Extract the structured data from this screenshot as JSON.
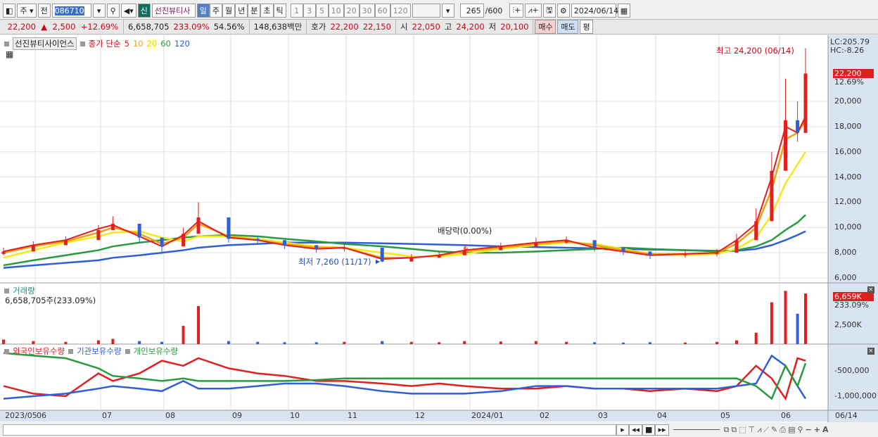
{
  "toolbar": {
    "market": "주",
    "prev_label": "전",
    "code": "086710",
    "name_badge": "신",
    "stock_name": "선진뷰티사",
    "periods": [
      "일",
      "주",
      "월",
      "년",
      "분",
      "초",
      "틱"
    ],
    "active_period": "일",
    "intervals": [
      "1",
      "3",
      "5",
      "10",
      "20",
      "30",
      "60",
      "120"
    ],
    "count": "265",
    "count_max": "/600",
    "date": "2024/06/14"
  },
  "quote": {
    "price": "22,200",
    "arrow": "▲",
    "change": "2,500",
    "change_pct": "+12.69%",
    "volume": "6,658,705",
    "volume_pct": "233.09%",
    "turnover": "54.56%",
    "amount": "148,638백만",
    "ask_label": "호가",
    "ask": "22,200",
    "bid": "22,150",
    "open_label": "시",
    "open": "22,050",
    "high_label": "고",
    "high": "24,200",
    "low_label": "저",
    "low": "20,100",
    "buy": "매수",
    "sell": "매도",
    "avg": "평"
  },
  "legend": {
    "stock": "선진뷰티사이언스",
    "ma_label": "종가 단순",
    "ma": [
      {
        "p": "5",
        "color": "#e0201e"
      },
      {
        "p": "10",
        "color": "#f0a010"
      },
      {
        "p": "20",
        "color": "#f0e020"
      },
      {
        "p": "60",
        "color": "#2a9a40"
      },
      {
        "p": "120",
        "color": "#2f5fd8"
      }
    ]
  },
  "annotations": {
    "high": "최고 24,200 (06/14)",
    "low": "최저 7,260 (11/17)",
    "dividend": "배당락(0.00%)"
  },
  "right_axis": {
    "lc": "LC:205.79",
    "hc": "HC:-8.26",
    "price_tag": "22,200",
    "pct_tag": "12.69%",
    "ticks": [
      "20,000",
      "18,000",
      "16,000",
      "14,000",
      "12,000",
      "10,000",
      "8,000",
      "6,000"
    ],
    "vol_tag": "6,659K",
    "vol_pct": "233.09%",
    "vol_tick": "2,500K",
    "inv_ticks": [
      "-500,000",
      "-1,000,000"
    ]
  },
  "volume_pane": {
    "title": "거래량",
    "value": "6,658,705주(233.09%)"
  },
  "investor_pane": {
    "series": [
      {
        "name": "외국인보유수량",
        "color": "#e0201e"
      },
      {
        "name": "기관보유수량",
        "color": "#2f5fd8"
      },
      {
        "name": "개인보유수량",
        "color": "#2a9a40"
      }
    ]
  },
  "x_axis": [
    "2023/05",
    "06",
    "07",
    "08",
    "09",
    "10",
    "11",
    "12",
    "2024/01",
    "02",
    "03",
    "04",
    "05",
    "06",
    "06/14"
  ],
  "chart_data": {
    "type": "candlestick",
    "ylim": [
      6000,
      24200
    ],
    "dates": [
      "2023-05-15",
      "2023-05-31",
      "2023-06-15",
      "2023-06-30",
      "2023-07-07",
      "2023-07-20",
      "2023-07-31",
      "2023-08-10",
      "2023-08-17",
      "2023-08-31",
      "2023-09-15",
      "2023-09-29",
      "2023-10-16",
      "2023-10-31",
      "2023-11-17",
      "2023-11-30",
      "2023-12-15",
      "2023-12-29",
      "2024-01-15",
      "2024-01-31",
      "2024-02-15",
      "2024-02-29",
      "2024-03-15",
      "2024-03-29",
      "2024-04-15",
      "2024-04-30",
      "2024-05-10",
      "2024-05-20",
      "2024-05-28",
      "2024-06-04",
      "2024-06-10",
      "2024-06-14"
    ],
    "close": [
      8100,
      8600,
      9000,
      9800,
      10300,
      9200,
      8500,
      9500,
      10800,
      9100,
      9000,
      8600,
      8300,
      8400,
      7300,
      7600,
      7800,
      8200,
      8500,
      8800,
      9000,
      8400,
      8100,
      7800,
      7900,
      8000,
      9000,
      10500,
      14500,
      18500,
      17500,
      22200
    ],
    "high": [
      8400,
      8900,
      9300,
      10200,
      10900,
      9600,
      8900,
      10000,
      12000,
      9500,
      9300,
      8900,
      8600,
      8700,
      7600,
      7900,
      8100,
      8500,
      8800,
      9200,
      9300,
      8700,
      8400,
      8100,
      8200,
      8300,
      9500,
      11500,
      16000,
      21800,
      20000,
      24200
    ],
    "low": [
      7800,
      8300,
      8700,
      9400,
      9800,
      8800,
      7900,
      9100,
      10100,
      8800,
      8700,
      8300,
      8000,
      8100,
      7260,
      7400,
      7600,
      7900,
      8200,
      8500,
      8700,
      8100,
      7800,
      7500,
      7600,
      7700,
      8600,
      10000,
      13500,
      16500,
      16800,
      20100
    ],
    "ma5": [
      8100,
      8600,
      9000,
      9900,
      10200,
      9300,
      8500,
      9400,
      10500,
      9200,
      9000,
      8600,
      8300,
      8400,
      7500,
      7600,
      7800,
      8200,
      8500,
      8800,
      9000,
      8400,
      8100,
      7800,
      7900,
      8000,
      9000,
      10300,
      14000,
      18000,
      17500,
      18800
    ],
    "ma10": [
      8000,
      8500,
      8900,
      9600,
      10000,
      9500,
      8700,
      9200,
      10300,
      9300,
      9000,
      8700,
      8400,
      8400,
      7600,
      7600,
      7800,
      8100,
      8400,
      8700,
      8900,
      8600,
      8200,
      7900,
      7900,
      8000,
      8700,
      10000,
      13000,
      17000,
      17500,
      18500
    ],
    "ma20": [
      7600,
      8200,
      8800,
      9300,
      9600,
      9700,
      9200,
      8900,
      9300,
      9300,
      9100,
      8800,
      8500,
      8400,
      8000,
      7700,
      7700,
      7900,
      8300,
      8600,
      8800,
      8700,
      8300,
      7900,
      7800,
      7900,
      8300,
      9200,
      11000,
      13500,
      15000,
      16000
    ],
    "ma60": [
      7000,
      7400,
      7800,
      8200,
      8500,
      8800,
      9000,
      9200,
      9300,
      9400,
      9300,
      9100,
      8900,
      8700,
      8500,
      8300,
      8100,
      8000,
      8000,
      8100,
      8200,
      8300,
      8400,
      8300,
      8200,
      8100,
      8200,
      8500,
      9000,
      9800,
      10400,
      11000
    ],
    "ma120": [
      6800,
      7000,
      7200,
      7400,
      7600,
      7800,
      8000,
      8200,
      8400,
      8600,
      8700,
      8800,
      8800,
      8800,
      8750,
      8700,
      8650,
      8600,
      8500,
      8450,
      8400,
      8350,
      8300,
      8250,
      8200,
      8150,
      8150,
      8300,
      8600,
      9000,
      9400,
      9700
    ],
    "volume_k": [
      600,
      400,
      300,
      500,
      700,
      400,
      300,
      2400,
      5000,
      400,
      300,
      250,
      250,
      300,
      400,
      300,
      250,
      400,
      350,
      400,
      300,
      250,
      200,
      250,
      200,
      300,
      500,
      1500,
      5500,
      7000,
      4000,
      6659
    ],
    "foreign": [
      -800000,
      -950000,
      -1000000,
      -550000,
      -700000,
      -550000,
      -300000,
      -400000,
      -250000,
      -450000,
      -550000,
      -600000,
      -700000,
      -700000,
      -750000,
      -800000,
      -750000,
      -800000,
      -850000,
      -850000,
      -800000,
      -850000,
      -850000,
      -900000,
      -850000,
      -900000,
      -800000,
      -400000,
      -650000,
      -1050000,
      -250000,
      -300000
    ],
    "institution": [
      -1050000,
      -1000000,
      -950000,
      -850000,
      -800000,
      -850000,
      -900000,
      -700000,
      -850000,
      -850000,
      -800000,
      -750000,
      -750000,
      -800000,
      -900000,
      -950000,
      -950000,
      -950000,
      -900000,
      -800000,
      -800000,
      -850000,
      -850000,
      -850000,
      -850000,
      -850000,
      -800000,
      -750000,
      -200000,
      -400000,
      -800000,
      -1050000
    ],
    "individual": [
      -150000,
      -200000,
      -250000,
      -450000,
      -600000,
      -650000,
      -700000,
      -650000,
      -700000,
      -700000,
      -700000,
      -700000,
      -680000,
      -650000,
      -650000,
      -650000,
      -650000,
      -650000,
      -650000,
      -650000,
      -650000,
      -650000,
      -650000,
      -650000,
      -650000,
      -650000,
      -650000,
      -800000,
      -1050000,
      -400000,
      -800000,
      -350000
    ]
  }
}
